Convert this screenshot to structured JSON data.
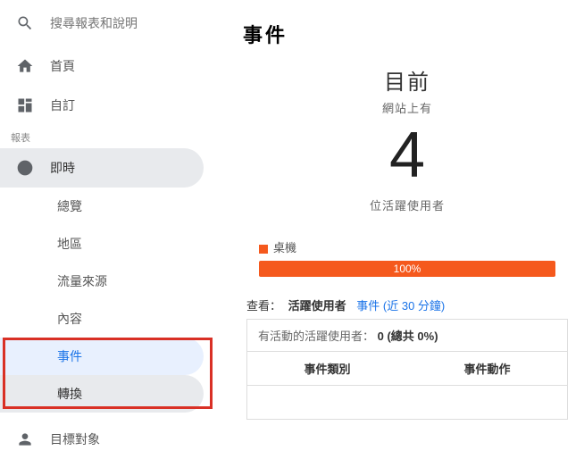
{
  "search": {
    "placeholder": "搜尋報表和說明"
  },
  "nav": {
    "home": "首頁",
    "custom": "自訂",
    "section_label": "報表",
    "realtime": "即時",
    "subs": {
      "overview": "總覽",
      "locations": "地區",
      "traffic": "流量來源",
      "content": "內容",
      "events": "事件",
      "conversions": "轉換"
    },
    "audience": "目標對象"
  },
  "main": {
    "title": "事件",
    "rt_now": "目前",
    "rt_onsite": "網站上有",
    "rt_number": "4",
    "rt_active": "位活躍使用者",
    "legend_desktop": "桌機",
    "bar_percent": "100%",
    "view_label": "查看：",
    "view_active": "活躍使用者",
    "view_link": "事件 (近 30 分鐘)",
    "info_prefix": "有活動的活躍使用者：",
    "info_value": "0 (總共 0%)",
    "col_category": "事件類別",
    "col_action": "事件動作"
  }
}
